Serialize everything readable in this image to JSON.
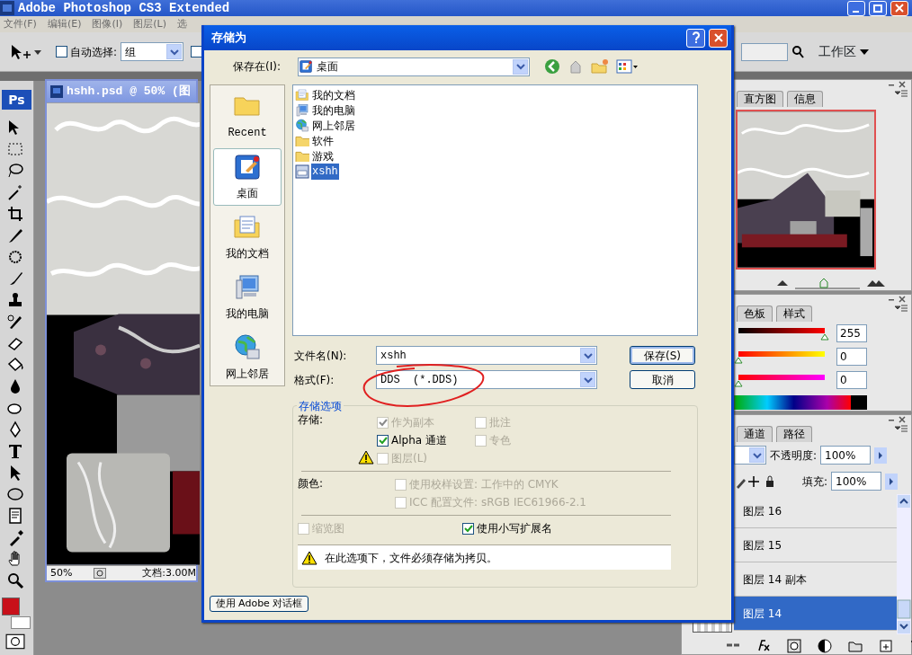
{
  "app": {
    "title": "Adobe Photoshop CS3 Extended"
  },
  "menu": [
    "文件(F)",
    "编辑(E)",
    "图像(I)",
    "图层(L)",
    "选"
  ],
  "options_bar": {
    "auto_select": {
      "label": "自动选择:",
      "checked": false
    },
    "auto_select_target": "组",
    "checkbox_2": {
      "checked": false
    },
    "workspace": "工作区"
  },
  "toolbox": {
    "logo": "Ps"
  },
  "document": {
    "title": "hshh.psd @ 50% (图",
    "zoom": "50%",
    "doc_info": "文档:3.00M"
  },
  "dialog": {
    "title": "存储为",
    "save_in_label": "保存在(I):",
    "save_in": "桌面",
    "places": [
      {
        "label": "Recent",
        "kind": "recent",
        "selected": false
      },
      {
        "label": "桌面",
        "kind": "desktop",
        "selected": true
      },
      {
        "label": "我的文档",
        "kind": "documents",
        "selected": false
      },
      {
        "label": "我的电脑",
        "kind": "computer",
        "selected": false
      },
      {
        "label": "网上邻居",
        "kind": "network",
        "selected": false
      }
    ],
    "files": [
      {
        "name": "我的文档",
        "kind": "documents",
        "selected": false
      },
      {
        "name": "我的电脑",
        "kind": "computer",
        "selected": false
      },
      {
        "name": "网上邻居",
        "kind": "network",
        "selected": false
      },
      {
        "name": "软件",
        "kind": "folder",
        "selected": false
      },
      {
        "name": "游戏",
        "kind": "folder",
        "selected": false
      },
      {
        "name": "xshh",
        "kind": "file",
        "selected": true
      }
    ],
    "filename_label": "文件名(N):",
    "filename": "xshh",
    "format_label": "格式(F):",
    "format": "DDS  (*.DDS)",
    "buttons": [
      {
        "label": "保存(S)",
        "default": true
      },
      {
        "label": "取消",
        "default": false
      }
    ],
    "options": {
      "legend": "存储选项",
      "save_label": "存储:",
      "save_checks": [
        {
          "label": "作为副本",
          "checked": true,
          "disabled": true,
          "warning": false
        },
        {
          "label": "批注",
          "checked": false,
          "disabled": true,
          "warning": false
        },
        {
          "label": "Alpha 通道",
          "checked": true,
          "disabled": false,
          "warning": false
        },
        {
          "label": "专色",
          "checked": false,
          "disabled": true,
          "warning": false
        },
        {
          "label": "图层(L)",
          "checked": false,
          "disabled": true,
          "warning": true
        }
      ],
      "color_label": "颜色:",
      "color_checks": [
        {
          "label": "使用校样设置: 工作中的 CMYK",
          "checked": false,
          "disabled": true
        },
        {
          "label": "ICC 配置文件: sRGB IEC61966-2.1",
          "checked": false,
          "disabled": true
        }
      ],
      "thumbnail": {
        "label": "缩览图",
        "checked": false,
        "disabled": true
      },
      "lowercase": {
        "label": "使用小写扩展名",
        "checked": true,
        "disabled": false
      },
      "warning": "在此选项下，文件必须存储为拷贝。"
    },
    "adobe_dialog_button": "使用 Adobe 对话框"
  },
  "navigator": {
    "tabs": [
      {
        "label": "直方图",
        "selected": false
      },
      {
        "label": "信息",
        "selected": false
      }
    ],
    "zoom_slider": {
      "level": 0.45
    }
  },
  "color_panel": {
    "tabs": [
      {
        "label": "色板",
        "selected": false
      },
      {
        "label": "样式",
        "selected": false
      }
    ],
    "channels": [
      {
        "level": 1,
        "value": "255"
      },
      {
        "level": 0,
        "value": "0"
      },
      {
        "level": 0,
        "value": "0"
      }
    ]
  },
  "layers_panel": {
    "tabs": [
      {
        "label": "通道",
        "selected": false
      },
      {
        "label": "路径",
        "selected": false
      }
    ],
    "opacity_label": "不透明度:",
    "opacity": "100%",
    "fill_label": "填充:",
    "fill": "100%",
    "layers": [
      {
        "name": "图层 16",
        "selected": false
      },
      {
        "name": "图层 15",
        "selected": false
      },
      {
        "name": "图层 14 副本",
        "selected": false
      },
      {
        "name": "图层 14",
        "selected": true
      }
    ]
  }
}
